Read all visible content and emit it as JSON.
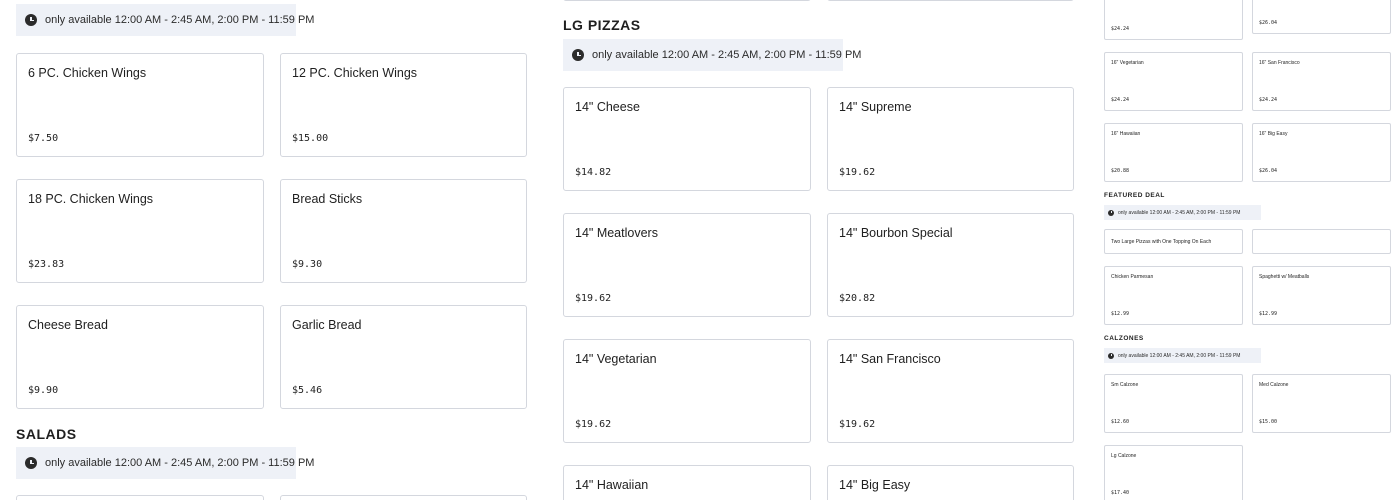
{
  "availability_text": "only available 12:00 AM - 2:45 AM, 2:00 PM - 11:59 PM",
  "sections": {
    "lg_pizzas": "LG PIZZAS",
    "salads": "SALADS",
    "featured_deal": "FEATURED DEAL",
    "calzones": "CALZONES"
  },
  "wings": [
    {
      "name": "6 PC. Chicken Wings",
      "price": "$7.50"
    },
    {
      "name": "12 PC. Chicken Wings",
      "price": "$15.00"
    },
    {
      "name": "18 PC. Chicken Wings",
      "price": "$23.83"
    },
    {
      "name": "Bread Sticks",
      "price": "$9.30"
    },
    {
      "name": "Cheese Bread",
      "price": "$9.90"
    },
    {
      "name": "Garlic Bread",
      "price": "$5.46"
    }
  ],
  "lg_pizzas": [
    {
      "name": "14\" Cheese",
      "price": "$14.82"
    },
    {
      "name": "14\" Supreme",
      "price": "$19.62"
    },
    {
      "name": "14\" Meatlovers",
      "price": "$19.62"
    },
    {
      "name": "14\" Bourbon Special",
      "price": "$20.82"
    },
    {
      "name": "14\" Vegetarian",
      "price": "$19.62"
    },
    {
      "name": "14\" San Francisco",
      "price": "$19.62"
    },
    {
      "name": "14\" Hawaiian",
      "price": ""
    },
    {
      "name": "14\" Big Easy",
      "price": ""
    }
  ],
  "xl_pizzas": [
    {
      "name": "",
      "price": "$24.24"
    },
    {
      "name": "",
      "price": "$26.04"
    },
    {
      "name": "16\" Vegetarian",
      "price": "$24.24"
    },
    {
      "name": "16\" San Francisco",
      "price": "$24.24"
    },
    {
      "name": "16\" Hawaiian",
      "price": "$20.88"
    },
    {
      "name": "16\" Big Easy",
      "price": "$26.04"
    }
  ],
  "featured": [
    {
      "name": "Two Large Pizzas with One Topping On Each",
      "price": ""
    },
    {
      "name": "",
      "price": ""
    },
    {
      "name": "Chicken Parmesan",
      "price": "$12.99"
    },
    {
      "name": "Spaghetti w/ Meatballs",
      "price": "$12.99"
    }
  ],
  "calzones": [
    {
      "name": "Sm Calzone",
      "price": "$12.60"
    },
    {
      "name": "Med Calzone",
      "price": "$15.00"
    },
    {
      "name": "Lg Calzone",
      "price": "$17.40"
    }
  ]
}
